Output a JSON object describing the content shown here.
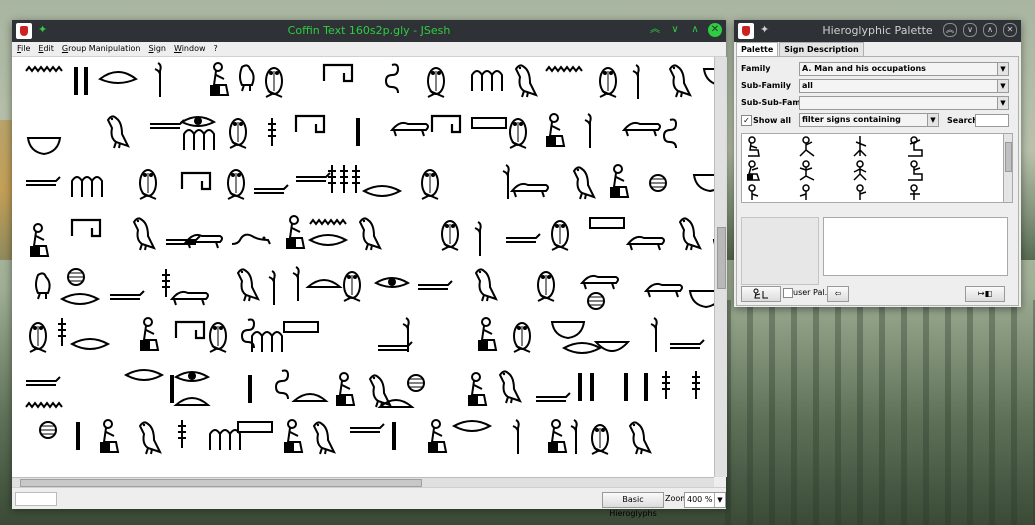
{
  "main_window": {
    "title": "Coffin Text 160s2p.gly - JSesh",
    "menu": [
      "File",
      "Edit",
      "Group Manipulation",
      "Sign",
      "Window",
      "?"
    ],
    "statusbar": {
      "mode_button": "Basic Hieroglyphs",
      "zoom_label": "Zoom",
      "zoom_value": "400 %"
    }
  },
  "palette_window": {
    "title": "Hieroglyphic Palette",
    "tabs": [
      "Palette",
      "Sign Description"
    ],
    "family_label": "Family",
    "family_value": "A. Man and his occupations",
    "subfamily_label": "Sub-Family",
    "subfamily_value": "all",
    "subsubfamily_label": "Sub-Sub-Family",
    "subsubfamily_value": "",
    "show_all_label": "Show all",
    "show_all_checked": true,
    "filter_value": "filter signs containing",
    "search_label": "Search",
    "search_value": "",
    "user_pal_label": "user Pal.",
    "user_pal_checked": false
  },
  "colors": {
    "titlebar_bg": "#2e3236",
    "titlebar_text_active": "#2ecc40",
    "titlebar_text_inactive": "#cfcfcf",
    "window_bg": "#eeeeee"
  },
  "icons": {
    "app": "jsesh-app-icon",
    "pin": "pin-icon",
    "keep_above": "chevron-up-icon",
    "minimize": "chevron-down-icon",
    "maximize": "caret-up-icon",
    "close": "close-icon",
    "back": "arrow-left-icon",
    "insert": "insert-sign-icon"
  }
}
